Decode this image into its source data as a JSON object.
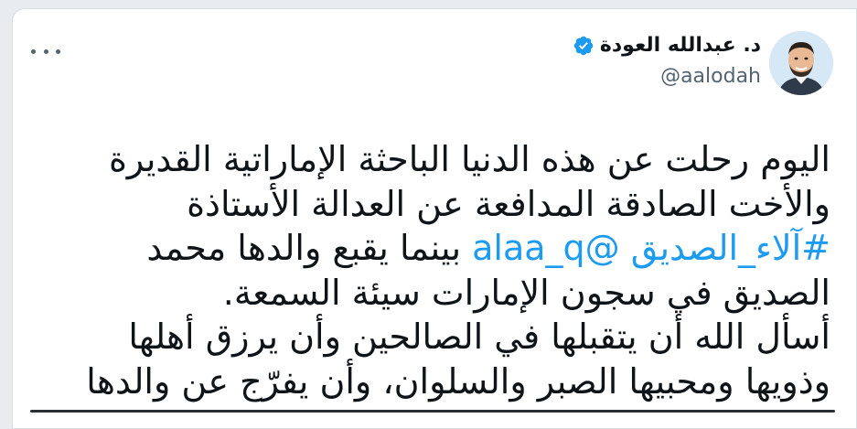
{
  "tweet": {
    "author": {
      "display_name": "د. عبدالله العودة",
      "handle": "@aalodah",
      "verified": true
    },
    "text_lines": [
      [
        "اليوم رحلت عن هذه الدنيا الباحثة الإماراتية القديرة"
      ],
      [
        "والأخت الصادقة المدافعة عن العدالة الأستاذة"
      ],
      [
        "#آلاء_الصديق",
        " ",
        "@alaa_q",
        " بينما يقبع والدها محمد"
      ],
      [
        "الصديق في سجون الإمارات سيئة السمعة."
      ],
      [
        "أسأل الله أن يتقبلها في الصالحين وأن يرزق أهلها"
      ],
      [
        "وذويها ومحبيها الصبر والسلوان، وأن يفرّج عن والدها"
      ]
    ],
    "line_1": "اليوم رحلت عن هذه الدنيا الباحثة الإماراتية القديرة",
    "line_2": "والأخت الصادقة المدافعة عن العدالة الأستاذة",
    "hashtag": "#آلاء_الصديق",
    "mention": "@alaa_q",
    "line_3_rest": " بينما يقبع والدها محمد",
    "line_4": "الصديق في سجون الإمارات سيئة السمعة.",
    "line_5": "أسأل الله أن يتقبلها في الصالحين وأن يرزق أهلها",
    "line_6": "وذويها ومحبيها الصبر والسلوان، وأن يفرّج عن والدها"
  },
  "icons": {
    "more": "more-horizontal-icon",
    "verified": "verified-badge-icon"
  },
  "colors": {
    "link": "#1d9bf0",
    "verified": "#1d9bf0",
    "text": "#0f1419",
    "secondary": "#536471"
  }
}
